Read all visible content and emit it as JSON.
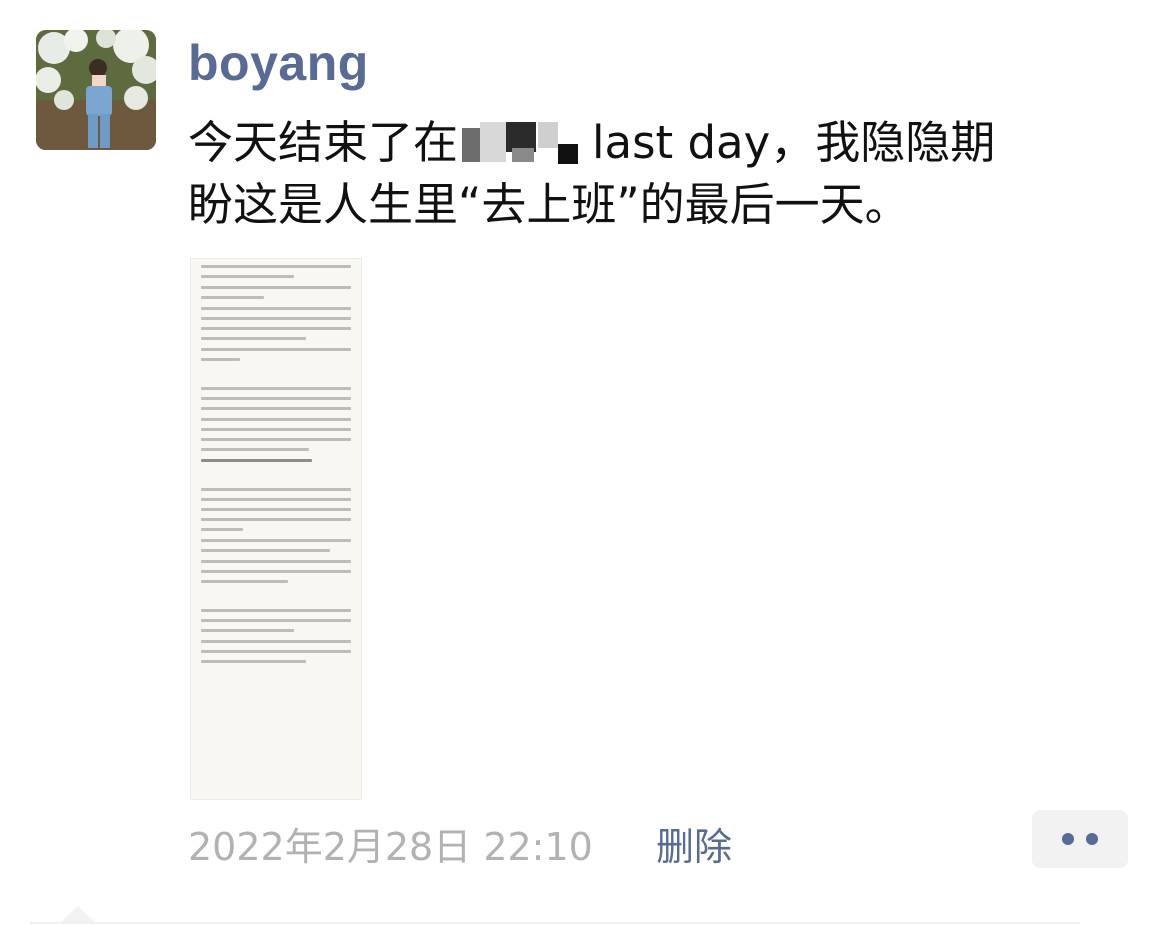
{
  "post": {
    "username": "boyang",
    "text_line1_before": "今天结束了在",
    "text_line1_after": "last day，我隐隐期",
    "text_line2": "盼这是人生里“去上班”的最后一天。",
    "timestamp": "2022年2月28日 22:10",
    "delete_label": "删除"
  },
  "icons": {
    "avatar": "user-avatar-photo",
    "more": "more-dots-icon"
  },
  "colors": {
    "link": "#576b95",
    "timestamp": "#b2b2b2"
  }
}
